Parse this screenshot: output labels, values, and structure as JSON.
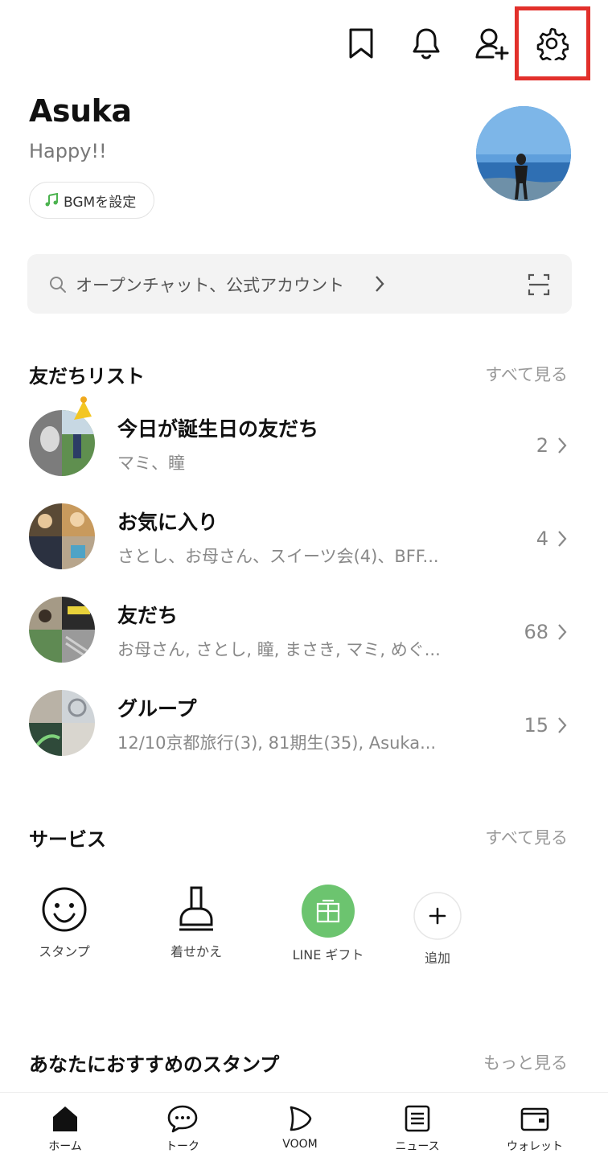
{
  "header": {
    "icons": [
      "bookmark-icon",
      "bell-icon",
      "add-friend-icon",
      "gear-icon"
    ],
    "highlight_color": "#e2302b"
  },
  "profile": {
    "name": "Asuka",
    "status": "Happy!!",
    "bgm_label": "BGMを設定"
  },
  "search": {
    "placeholder": "オープンチャット、公式アカウント"
  },
  "friends_section": {
    "title": "友だちリスト",
    "see_all": "すべて見る",
    "rows": [
      {
        "title": "今日が誕生日の友だち",
        "subtitle": "マミ、瞳",
        "count": "2"
      },
      {
        "title": "お気に入り",
        "subtitle": "さとし、お母さん、スイーツ会(4)、BFF...",
        "count": "4"
      },
      {
        "title": "友だち",
        "subtitle": "お母さん, さとし, 瞳, まさき, マミ, めぐ...",
        "count": "68"
      },
      {
        "title": "グループ",
        "subtitle": "12/10京都旅行(3), 81期生(35), Asuka...",
        "count": "15"
      }
    ]
  },
  "services_section": {
    "title": "サービス",
    "see_all": "すべて見る",
    "items": [
      {
        "label": "スタンプ",
        "icon": "smiley-icon"
      },
      {
        "label": "着せかえ",
        "icon": "brush-icon"
      },
      {
        "label": "LINE ギフト",
        "icon": "gift-icon"
      },
      {
        "label": "追加",
        "icon": "plus-icon"
      }
    ],
    "accent": "#6cc46f"
  },
  "stamps_section": {
    "title": "あなたにおすすめのスタンプ",
    "see_more": "もっと見る"
  },
  "bottom_nav": {
    "items": [
      {
        "label": "ホーム",
        "icon": "home-icon"
      },
      {
        "label": "トーク",
        "icon": "chat-icon"
      },
      {
        "label": "VOOM",
        "icon": "voom-icon"
      },
      {
        "label": "ニュース",
        "icon": "news-icon"
      },
      {
        "label": "ウォレット",
        "icon": "wallet-icon"
      }
    ]
  }
}
